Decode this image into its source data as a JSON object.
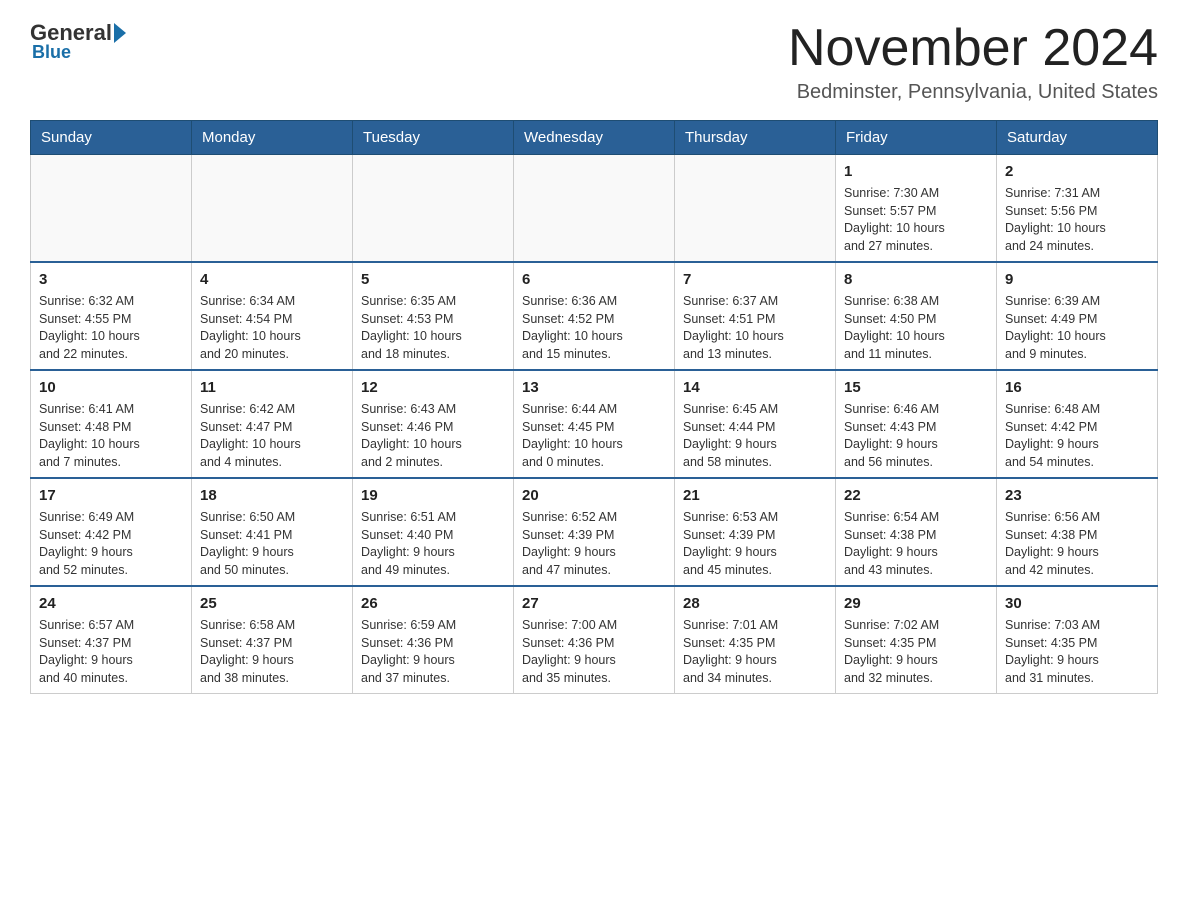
{
  "logo": {
    "general": "General",
    "blue": "Blue",
    "tagline": "Blue"
  },
  "header": {
    "title": "November 2024",
    "subtitle": "Bedminster, Pennsylvania, United States"
  },
  "weekdays": [
    "Sunday",
    "Monday",
    "Tuesday",
    "Wednesday",
    "Thursday",
    "Friday",
    "Saturday"
  ],
  "weeks": [
    [
      {
        "day": "",
        "info": ""
      },
      {
        "day": "",
        "info": ""
      },
      {
        "day": "",
        "info": ""
      },
      {
        "day": "",
        "info": ""
      },
      {
        "day": "",
        "info": ""
      },
      {
        "day": "1",
        "info": "Sunrise: 7:30 AM\nSunset: 5:57 PM\nDaylight: 10 hours\nand 27 minutes."
      },
      {
        "day": "2",
        "info": "Sunrise: 7:31 AM\nSunset: 5:56 PM\nDaylight: 10 hours\nand 24 minutes."
      }
    ],
    [
      {
        "day": "3",
        "info": "Sunrise: 6:32 AM\nSunset: 4:55 PM\nDaylight: 10 hours\nand 22 minutes."
      },
      {
        "day": "4",
        "info": "Sunrise: 6:34 AM\nSunset: 4:54 PM\nDaylight: 10 hours\nand 20 minutes."
      },
      {
        "day": "5",
        "info": "Sunrise: 6:35 AM\nSunset: 4:53 PM\nDaylight: 10 hours\nand 18 minutes."
      },
      {
        "day": "6",
        "info": "Sunrise: 6:36 AM\nSunset: 4:52 PM\nDaylight: 10 hours\nand 15 minutes."
      },
      {
        "day": "7",
        "info": "Sunrise: 6:37 AM\nSunset: 4:51 PM\nDaylight: 10 hours\nand 13 minutes."
      },
      {
        "day": "8",
        "info": "Sunrise: 6:38 AM\nSunset: 4:50 PM\nDaylight: 10 hours\nand 11 minutes."
      },
      {
        "day": "9",
        "info": "Sunrise: 6:39 AM\nSunset: 4:49 PM\nDaylight: 10 hours\nand 9 minutes."
      }
    ],
    [
      {
        "day": "10",
        "info": "Sunrise: 6:41 AM\nSunset: 4:48 PM\nDaylight: 10 hours\nand 7 minutes."
      },
      {
        "day": "11",
        "info": "Sunrise: 6:42 AM\nSunset: 4:47 PM\nDaylight: 10 hours\nand 4 minutes."
      },
      {
        "day": "12",
        "info": "Sunrise: 6:43 AM\nSunset: 4:46 PM\nDaylight: 10 hours\nand 2 minutes."
      },
      {
        "day": "13",
        "info": "Sunrise: 6:44 AM\nSunset: 4:45 PM\nDaylight: 10 hours\nand 0 minutes."
      },
      {
        "day": "14",
        "info": "Sunrise: 6:45 AM\nSunset: 4:44 PM\nDaylight: 9 hours\nand 58 minutes."
      },
      {
        "day": "15",
        "info": "Sunrise: 6:46 AM\nSunset: 4:43 PM\nDaylight: 9 hours\nand 56 minutes."
      },
      {
        "day": "16",
        "info": "Sunrise: 6:48 AM\nSunset: 4:42 PM\nDaylight: 9 hours\nand 54 minutes."
      }
    ],
    [
      {
        "day": "17",
        "info": "Sunrise: 6:49 AM\nSunset: 4:42 PM\nDaylight: 9 hours\nand 52 minutes."
      },
      {
        "day": "18",
        "info": "Sunrise: 6:50 AM\nSunset: 4:41 PM\nDaylight: 9 hours\nand 50 minutes."
      },
      {
        "day": "19",
        "info": "Sunrise: 6:51 AM\nSunset: 4:40 PM\nDaylight: 9 hours\nand 49 minutes."
      },
      {
        "day": "20",
        "info": "Sunrise: 6:52 AM\nSunset: 4:39 PM\nDaylight: 9 hours\nand 47 minutes."
      },
      {
        "day": "21",
        "info": "Sunrise: 6:53 AM\nSunset: 4:39 PM\nDaylight: 9 hours\nand 45 minutes."
      },
      {
        "day": "22",
        "info": "Sunrise: 6:54 AM\nSunset: 4:38 PM\nDaylight: 9 hours\nand 43 minutes."
      },
      {
        "day": "23",
        "info": "Sunrise: 6:56 AM\nSunset: 4:38 PM\nDaylight: 9 hours\nand 42 minutes."
      }
    ],
    [
      {
        "day": "24",
        "info": "Sunrise: 6:57 AM\nSunset: 4:37 PM\nDaylight: 9 hours\nand 40 minutes."
      },
      {
        "day": "25",
        "info": "Sunrise: 6:58 AM\nSunset: 4:37 PM\nDaylight: 9 hours\nand 38 minutes."
      },
      {
        "day": "26",
        "info": "Sunrise: 6:59 AM\nSunset: 4:36 PM\nDaylight: 9 hours\nand 37 minutes."
      },
      {
        "day": "27",
        "info": "Sunrise: 7:00 AM\nSunset: 4:36 PM\nDaylight: 9 hours\nand 35 minutes."
      },
      {
        "day": "28",
        "info": "Sunrise: 7:01 AM\nSunset: 4:35 PM\nDaylight: 9 hours\nand 34 minutes."
      },
      {
        "day": "29",
        "info": "Sunrise: 7:02 AM\nSunset: 4:35 PM\nDaylight: 9 hours\nand 32 minutes."
      },
      {
        "day": "30",
        "info": "Sunrise: 7:03 AM\nSunset: 4:35 PM\nDaylight: 9 hours\nand 31 minutes."
      }
    ]
  ]
}
